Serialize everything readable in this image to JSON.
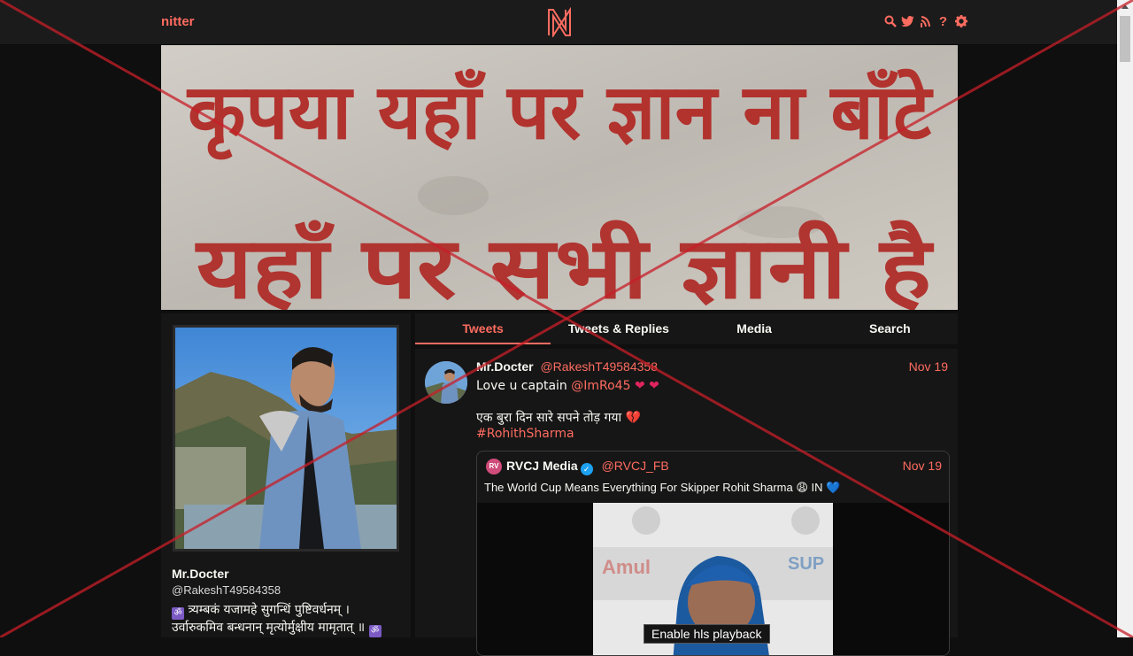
{
  "navbar": {
    "brand": "nitter",
    "logo_letter": "N",
    "icons": [
      "search-icon",
      "twitter-bird-icon",
      "rss-icon",
      "help-icon",
      "gear-icon"
    ],
    "icon_glyphs": {
      "help": "?"
    }
  },
  "banner": {
    "line1": "कृपया यहाँ पर ज्ञान ना बाँटे",
    "line2": "यहाँ पर सभी ज्ञानी है"
  },
  "profile": {
    "name": "Mr.Docter",
    "handle": "@RakeshT49584358",
    "bio_line1": "त्र्यम्बकं यजामहे सुगन्धिं पुष्टिवर्धनम् ।",
    "bio_line2": "उर्वारुकमिव बन्धनान् मृत्योर्मुक्षीय मामृतात् ॥",
    "om_glyph": "ॐ"
  },
  "tabs": [
    "Tweets",
    "Tweets & Replies",
    "Media",
    "Search"
  ],
  "tweet": {
    "name": "Mr.Docter",
    "username": "@RakeshT49584358",
    "date": "Nov 19",
    "text_prefix": "Love u captain",
    "mention": "@ImRo45",
    "hearts": "❤ ❤",
    "line2": "एक बुरा दिन सारे सपने तोड़ गया",
    "broken_heart": "💔",
    "hashtag": "#RohithSharma",
    "quote": {
      "name": "RVCJ Media",
      "verified_glyph": "✓",
      "username": "@RVCJ_FB",
      "date": "Nov 19",
      "text": "The World Cup Means Everything For Skipper Rohit Sharma",
      "text_suffix": "😩 IN 💙",
      "video_button": "Enable hls playback"
    }
  },
  "colors": {
    "accent": "#ff6c60",
    "background": "#0f0f0f",
    "panel": "#161616",
    "navbar": "#1b1b1b",
    "overlay_x": "#c81e28"
  }
}
